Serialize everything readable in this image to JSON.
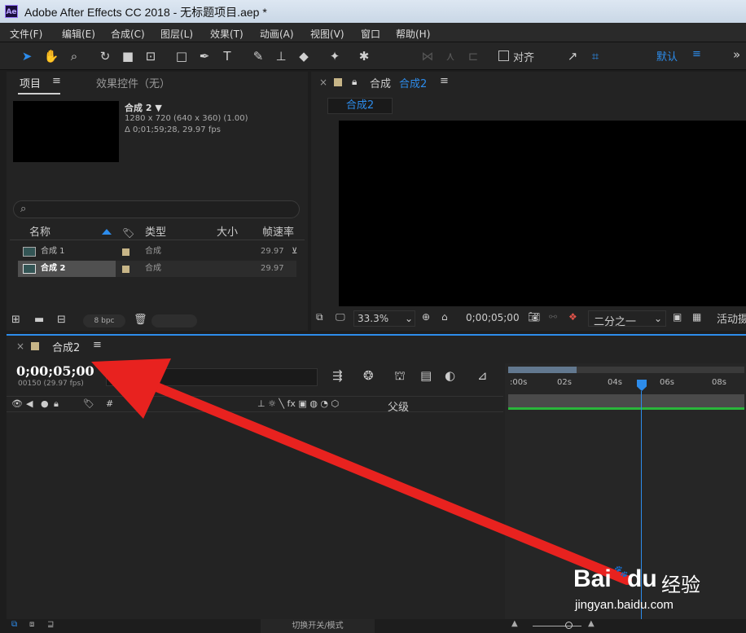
{
  "window": {
    "title": "Adobe After Effects CC 2018 - 无标题项目.aep *",
    "logo": "Ae"
  },
  "menu": [
    "文件(F)",
    "编辑(E)",
    "合成(C)",
    "图层(L)",
    "效果(T)",
    "动画(A)",
    "视图(V)",
    "窗口",
    "帮助(H)"
  ],
  "toolbar": {
    "align_label": "对齐",
    "workspace_label": "默认",
    "menu_icon": "≡",
    "more": "»"
  },
  "project": {
    "tab_project": "项目",
    "tab_effects": "效果控件（无）",
    "menu_icon": "≡",
    "selected_name": "合成 2 ▼",
    "selected_size": "1280 x 720  (640 x 360) (1.00)",
    "selected_duration": "Δ 0;01;59;28, 29.97 fps",
    "search_icon": "⌕",
    "columns": {
      "name": "名称",
      "type": "类型",
      "size": "大小",
      "fps": "帧速率"
    },
    "items": [
      {
        "name": "合成 1",
        "type": "合成",
        "fps": "29.97"
      },
      {
        "name": "合成 2",
        "type": "合成",
        "fps": "29.97"
      }
    ],
    "bpc": "8 bpc"
  },
  "viewer": {
    "tab_prefix": "合成",
    "tab_name": "合成2",
    "sub_tab": "合成2",
    "zoom": "33.3%",
    "timecode": "0;00;05;00",
    "resolution": "二分之一",
    "active_camera": "活动摄"
  },
  "timeline": {
    "tab": "合成2",
    "timecode": "0;00;05;00",
    "frame_info": "00150 (29.97 fps)",
    "hash_label": "#",
    "parent_label": "父级",
    "ruler": [
      ":00s",
      "02s",
      "04s",
      "06s",
      "08s"
    ],
    "bottom_label": "切换开关/模式"
  },
  "watermark": {
    "brand": "Bai",
    "brand2": "du",
    "jingyan": "经验",
    "url": "jingyan.baidu.com"
  },
  "colors": {
    "accent": "#2d8ceb",
    "arrow": "#e8221f",
    "label": "#c7b587",
    "green": "#29b53a"
  }
}
